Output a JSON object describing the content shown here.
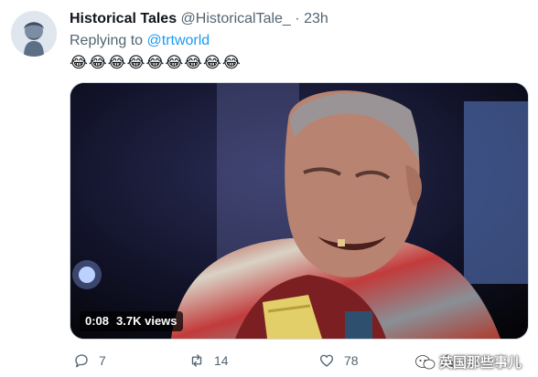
{
  "tweet": {
    "display_name": "Historical Tales",
    "handle": "@HistoricalTale_",
    "separator": "·",
    "time": "23h",
    "replying_prefix": "Replying to",
    "replying_to": "@trtworld",
    "text": "😂😂😂😂😂😂😂😂😂",
    "avatar_icon": "statue-avatar-icon"
  },
  "video": {
    "duration": "0:08",
    "views": "3.7K views"
  },
  "actions": {
    "reply_count": "7",
    "retweet_count": "14",
    "like_count": "78",
    "share_icon": "share-icon"
  },
  "watermark": {
    "text": "英国那些事儿"
  }
}
